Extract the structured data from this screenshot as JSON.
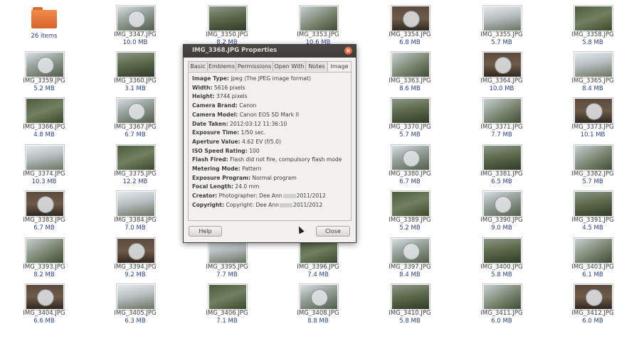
{
  "folder": {
    "label": "26 items"
  },
  "files": [
    {
      "name": "IMG_3347.JPG",
      "size": "10.0 MB"
    },
    {
      "name": "IMG_3350.JPG",
      "size": "8.2 MB"
    },
    {
      "name": "IMG_3353.JPG",
      "size": "10.6 MB"
    },
    {
      "name": "IMG_3354.JPG",
      "size": "6.8 MB"
    },
    {
      "name": "IMG_3355.JPG",
      "size": "5.7 MB"
    },
    {
      "name": "IMG_3358.JPG",
      "size": "5.8 MB"
    },
    {
      "name": "IMG_3359.JPG",
      "size": "5.2 MB"
    },
    {
      "name": "IMG_3360.JPG",
      "size": "3.1 MB"
    },
    {
      "name": "IMG_3363.JPG",
      "size": "8.6 MB"
    },
    {
      "name": "IMG_3364.JPG",
      "size": "10.0 MB"
    },
    {
      "name": "IMG_3365.JPG",
      "size": "8.4 MB"
    },
    {
      "name": "IMG_3366.JPG",
      "size": "4.8 MB"
    },
    {
      "name": "IMG_3367.JPG",
      "size": "6.7 MB"
    },
    {
      "name": "IMG_3370.JPG",
      "size": "5.7 MB"
    },
    {
      "name": "IMG_3371.JPG",
      "size": "7.7 MB"
    },
    {
      "name": "IMG_3373.JPG",
      "size": "10.1 MB"
    },
    {
      "name": "IMG_3374.JPG",
      "size": "10.3 MB"
    },
    {
      "name": "IMG_3375.JPG",
      "size": "12.2 MB"
    },
    {
      "name": "IMG_3380.JPG",
      "size": "6.7 MB"
    },
    {
      "name": "IMG_3381.JPG",
      "size": "6.5 MB"
    },
    {
      "name": "IMG_3382.JPG",
      "size": "5.7 MB"
    },
    {
      "name": "IMG_3383.JPG",
      "size": "6.7 MB"
    },
    {
      "name": "IMG_3384.JPG",
      "size": "7.0 MB"
    },
    {
      "name": "IMG_3389.JPG",
      "size": "5.2 MB"
    },
    {
      "name": "IMG_3390.JPG",
      "size": "9.0 MB"
    },
    {
      "name": "IMG_3391.JPG",
      "size": "4.5 MB"
    },
    {
      "name": "IMG_3393.JPG",
      "size": "8.2 MB"
    },
    {
      "name": "IMG_3394.JPG",
      "size": "9.2 MB"
    },
    {
      "name": "IMG_3395.JPG",
      "size": "7.7 MB"
    },
    {
      "name": "IMG_3396.JPG",
      "size": "7.4 MB"
    },
    {
      "name": "IMG_3397.JPG",
      "size": "8.4 MB"
    },
    {
      "name": "IMG_3400.JPG",
      "size": "5.8 MB"
    },
    {
      "name": "IMG_3403.JPG",
      "size": "6.1 MB"
    },
    {
      "name": "IMG_3404.JPG",
      "size": "6.6 MB"
    },
    {
      "name": "IMG_3405.JPG",
      "size": "6.3 MB"
    },
    {
      "name": "IMG_3406.JPG",
      "size": "7.1 MB"
    },
    {
      "name": "IMG_3408.JPG",
      "size": "8.8 MB"
    },
    {
      "name": "IMG_3410.JPG",
      "size": "5.8 MB"
    },
    {
      "name": "IMG_3411.JPG",
      "size": "6.0 MB"
    },
    {
      "name": "IMG_3412.JPG",
      "size": "6.0 MB"
    }
  ],
  "dialog": {
    "title": "IMG_3368.JPG Properties",
    "tabs": [
      "Basic",
      "Emblems",
      "Permissions",
      "Open With",
      "Notes",
      "Image"
    ],
    "active_tab": "Image",
    "properties": [
      {
        "label": "Image Type:",
        "value": "jpeg (The JPEG image format)"
      },
      {
        "label": "Width:",
        "value": "5616 pixels"
      },
      {
        "label": "Height:",
        "value": "3744 pixels"
      },
      {
        "label": "Camera Brand:",
        "value": "Canon"
      },
      {
        "label": "Camera Model:",
        "value": "Canon EOS 5D Mark II"
      },
      {
        "label": "Date Taken:",
        "value": "2012:03:12 11:36:10"
      },
      {
        "label": "Exposure Time:",
        "value": "1/50 sec."
      },
      {
        "label": "Aperture Value:",
        "value": "4.62 EV (f/5.0)"
      },
      {
        "label": "ISO Speed Rating:",
        "value": "100"
      },
      {
        "label": "Flash Fired:",
        "value": "Flash did not fire, compulsory flash mode"
      },
      {
        "label": "Metering Mode:",
        "value": "Pattern"
      },
      {
        "label": "Exposure Program:",
        "value": "Normal program"
      },
      {
        "label": "Focal Length:",
        "value": "24.0 mm"
      },
      {
        "label": "Creator:",
        "value": "Photographer: Dee Ann",
        "suffix": "2011/2012"
      },
      {
        "label": "Copyright:",
        "value": "Copyright: Dee Ann",
        "suffix": "2011/2012"
      }
    ],
    "help_label": "Help",
    "close_label": "Close"
  }
}
